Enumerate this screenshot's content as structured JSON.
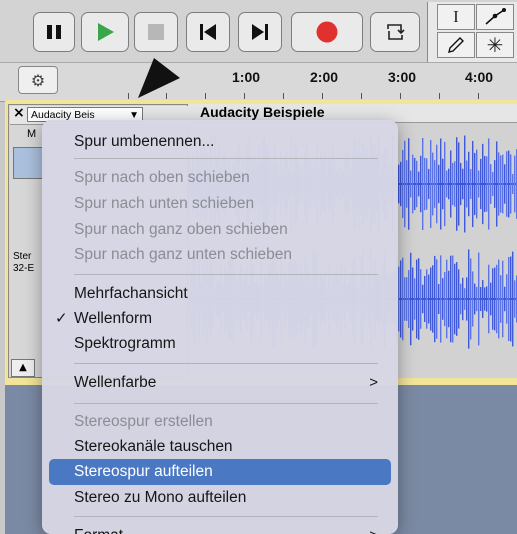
{
  "transport": {
    "pause": "pause-icon",
    "play": "play-icon",
    "stop": "stop-icon",
    "skip_start": "skip-to-start-icon",
    "skip_end": "skip-to-end-icon",
    "record": "record-icon",
    "loop": "loop-icon",
    "colors": {
      "play": "#3aa64a",
      "record": "#e0312f"
    }
  },
  "tools": {
    "selection": "I",
    "envelope": "envelope-icon",
    "draw": "pencil-icon",
    "multi": "✳"
  },
  "ruler": {
    "ticks": [
      "1:00",
      "2:00",
      "3:00",
      "4:00"
    ]
  },
  "track": {
    "close": "×",
    "name_button": "Audacity Beis",
    "title": "Audacity Beispiele",
    "side_letter": "M",
    "info_line1": "Ster",
    "info_line2": "32-E"
  },
  "menu": {
    "items": [
      {
        "label": "Spur umbenennen...",
        "enabled": true
      },
      {
        "label": "Spur nach oben schieben",
        "enabled": false
      },
      {
        "label": "Spur nach unten schieben",
        "enabled": false
      },
      {
        "label": "Spur nach ganz oben schieben",
        "enabled": false
      },
      {
        "label": "Spur nach ganz unten schieben",
        "enabled": false
      },
      {
        "label": "Mehrfachansicht",
        "enabled": true
      },
      {
        "label": "Wellenform",
        "enabled": true,
        "checked": true
      },
      {
        "label": "Spektrogramm",
        "enabled": true
      },
      {
        "label": "Wellenfarbe",
        "enabled": true,
        "submenu": true
      },
      {
        "label": "Stereospur erstellen",
        "enabled": false
      },
      {
        "label": "Stereokanäle tauschen",
        "enabled": true
      },
      {
        "label": "Stereospur aufteilen",
        "enabled": true,
        "highlighted": true
      },
      {
        "label": "Stereo zu Mono aufteilen",
        "enabled": true
      },
      {
        "label": "Format",
        "enabled": true,
        "submenu": true
      }
    ],
    "check_glyph": "✓",
    "submenu_glyph": ">"
  }
}
